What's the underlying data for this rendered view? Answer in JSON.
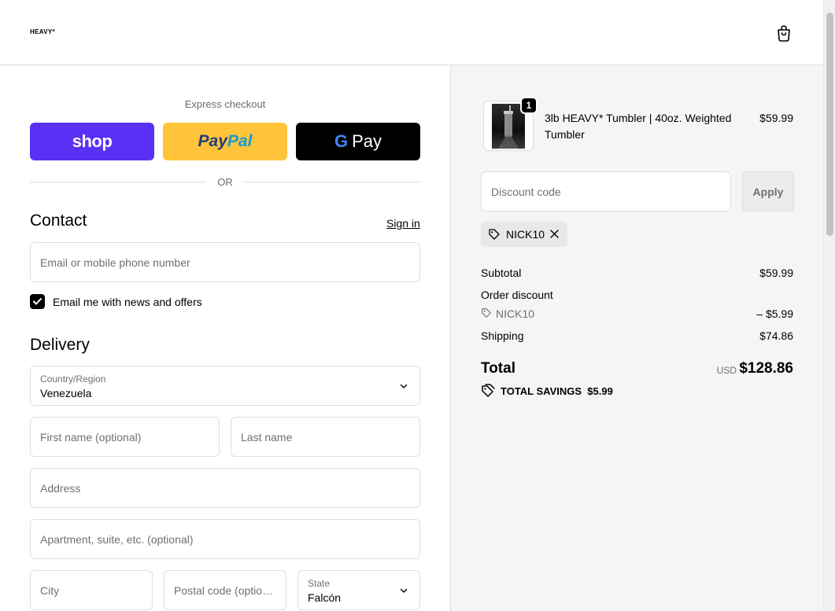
{
  "header": {
    "logo": "HEAVY*"
  },
  "express": {
    "label": "Express checkout",
    "shop_label": "shop",
    "paypal_part1": "Pay",
    "paypal_part2": "Pal",
    "gpay_g": "G",
    "gpay_label": "Pay",
    "or_label": "OR"
  },
  "contact": {
    "title": "Contact",
    "signin_label": "Sign in",
    "email_placeholder": "Email or mobile phone number",
    "newsletter_label": "Email me with news and offers",
    "newsletter_checked": true
  },
  "delivery": {
    "title": "Delivery",
    "country_label": "Country/Region",
    "country_value": "Venezuela",
    "first_name_placeholder": "First name (optional)",
    "last_name_placeholder": "Last name",
    "address_placeholder": "Address",
    "apartment_placeholder": "Apartment, suite, etc. (optional)",
    "city_placeholder": "City",
    "postal_placeholder": "Postal code (optional)",
    "state_label": "State",
    "state_value": "Falcón"
  },
  "order": {
    "item": {
      "name": "3lb HEAVY* Tumbler | 40oz. Weighted Tumbler",
      "price": "$59.99",
      "quantity": "1"
    },
    "discount_placeholder": "Discount code",
    "apply_label": "Apply",
    "applied_code": "NICK10",
    "subtotal_label": "Subtotal",
    "subtotal_value": "$59.99",
    "order_discount_label": "Order discount",
    "discount_code_label": "NICK10",
    "discount_value": "– $5.99",
    "shipping_label": "Shipping",
    "shipping_value": "$74.86",
    "total_label": "Total",
    "currency": "USD",
    "total_value": "$128.86",
    "savings_label": "TOTAL SAVINGS",
    "savings_value": "$5.99"
  },
  "colors": {
    "shop_purple": "#5a31f4",
    "paypal_yellow": "#ffc439",
    "gpay_black": "#000000",
    "summary_bg": "#f5f5f5"
  },
  "icons": [
    "shopping-bag-icon",
    "checkmark-icon",
    "chevron-down-icon",
    "tag-icon",
    "close-icon",
    "savings-tag-icon"
  ]
}
